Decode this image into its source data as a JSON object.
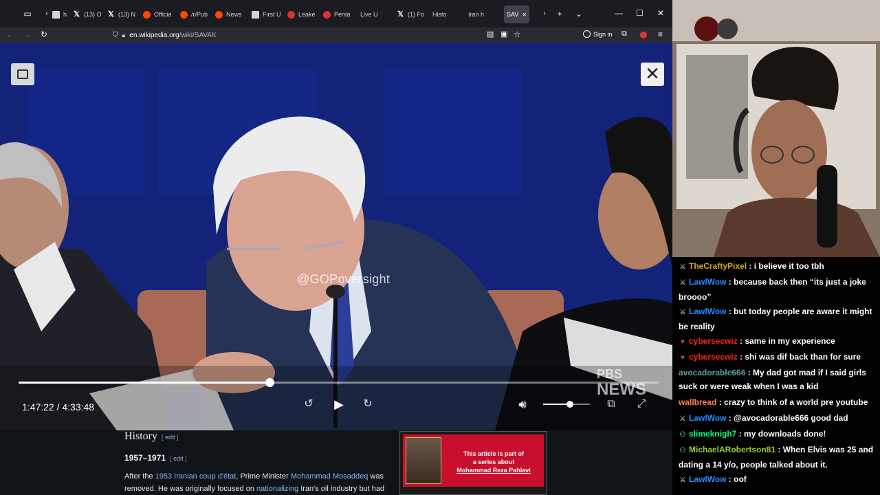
{
  "browser": {
    "tabs": [
      {
        "icon": "doc",
        "label": "h"
      },
      {
        "icon": "x",
        "label": "(13) O"
      },
      {
        "icon": "x",
        "label": "(13) N"
      },
      {
        "icon": "reddit",
        "label": "Officia"
      },
      {
        "icon": "reddit",
        "label": "/r/Pub"
      },
      {
        "icon": "reddit",
        "label": "News"
      },
      {
        "icon": "doc",
        "label": "First U"
      },
      {
        "icon": "sq",
        "label": "Leake"
      },
      {
        "icon": "sq",
        "label": "Penta"
      },
      {
        "icon": "none",
        "label": "Live U"
      },
      {
        "icon": "x",
        "label": "(1) Fo"
      },
      {
        "icon": "wiki",
        "label": "Histo"
      },
      {
        "icon": "wiki",
        "label": "Iran h"
      },
      {
        "icon": "wiki",
        "label": "SAV"
      }
    ],
    "url_host": "en.wikipedia.org",
    "url_path": "/wiki/SAVAK",
    "signin_label": "Sign in"
  },
  "video": {
    "watermark": "@GOPoversight",
    "logo_line1": "PBS",
    "logo_line2": "NEWS",
    "time_current": "1:47:22",
    "time_total": "4:33:48",
    "time_display": "1:47:22 / 4:33:48",
    "progress_fraction": 0.392,
    "volume_fraction": 0.58
  },
  "wiki": {
    "section_title": "History",
    "edit_label": "edit",
    "subsection_title": "1957–1971",
    "para_1": "After the ",
    "link_coup": "1953 Iranian coup d'état",
    "para_2": ", Prime Minister ",
    "link_pm": "Mohammad Mosaddeq",
    "para_3": " was removed. He was originally focused on ",
    "link_nat": "nationalizing",
    "para_4": " Iran's oil industry but had",
    "infobox_line1": "This article is part of",
    "infobox_line2": "a series about",
    "infobox_link": "Mohammad Reza Pahlavi"
  },
  "chat": [
    {
      "badge": "mod",
      "user": "TheCraftyPixel",
      "color": "#daa520",
      "text": ": i believe it too tbh"
    },
    {
      "badge": "mod",
      "user": "LawlWow",
      "color": "#1e90ff",
      "text": ": because back then “its just a joke broooo”"
    },
    {
      "badge": "mod",
      "user": "LawlWow",
      "color": "#1e90ff",
      "text": ": but today people are aware it might be reality"
    },
    {
      "badge": "heart",
      "user": "cybersecwiz",
      "color": "#ff2020",
      "text": ": same in my experience"
    },
    {
      "badge": "heart",
      "user": "cybersecwiz",
      "color": "#ff2020",
      "text": ": shi was dif back than for sure"
    },
    {
      "badge": "none",
      "user": "avocadorable666",
      "color": "#5f9ea0",
      "text": ": My dad got mad if I said girls suck or were weak when I was a kid"
    },
    {
      "badge": "none",
      "user": "wallbread",
      "color": "#ff7f50",
      "text": ": crazy to think of a world pre youtube"
    },
    {
      "badge": "mod",
      "user": "LawlWow",
      "color": "#1e90ff",
      "text": ": @avocadorable666 good dad"
    },
    {
      "badge": "person",
      "user": "slimeknigh7",
      "color": "#00ff7f",
      "text": ": my downloads done!"
    },
    {
      "badge": "person",
      "user": "MichaelARobertson81",
      "color": "#9acd32",
      "text": ": When Elvis was 25 and dating a 14 y/o, people talked about it."
    },
    {
      "badge": "mod",
      "user": "LawlWow",
      "color": "#1e90ff",
      "text": ": oof"
    }
  ]
}
